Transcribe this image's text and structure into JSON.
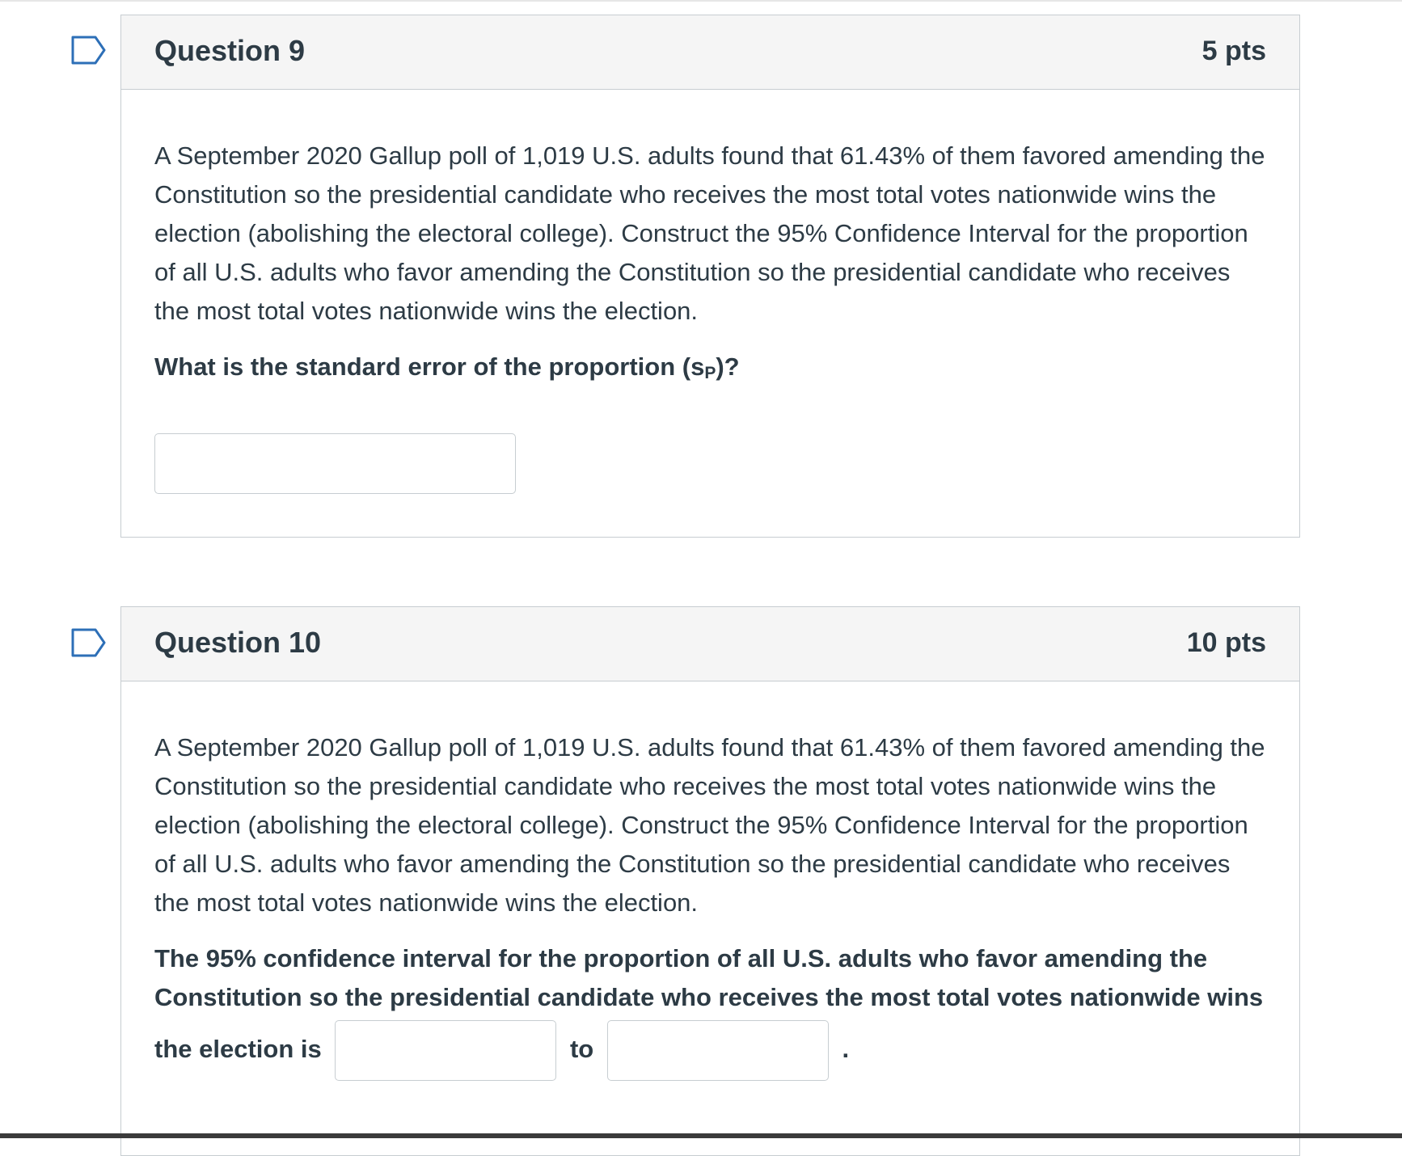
{
  "questions": [
    {
      "title": "Question 9",
      "points": "5 pts",
      "text": "A September 2020 Gallup poll of 1,019 U.S. adults found that 61.43% of them favored amending the Constitution so the presidential candidate who receives the most total votes nationwide wins the election (abolishing the electoral college). Construct the 95% Confidence Interval for the proportion of all U.S. adults who favor amending the Constitution so the presidential candidate who receives the most total votes nationwide wins the election.",
      "prompt_before": "What is the standard error of the proportion (s",
      "prompt_sub": "P",
      "prompt_after": ")?",
      "answer_value": ""
    },
    {
      "title": "Question 10",
      "points": "10 pts",
      "text": "A September 2020 Gallup poll of 1,019 U.S. adults found that 61.43% of them favored amending the Constitution so the presidential candidate who receives the most total votes nationwide wins the election (abolishing the electoral college). Construct the 95% Confidence Interval for the proportion of all U.S. adults who favor amending the Constitution so the presidential candidate who receives the most total votes nationwide wins the election.",
      "prompt": "The 95% confidence interval for the proportion of all U.S. adults who favor amending the Constitution so the presidential candidate who receives the most total votes nationwide wins",
      "prompt_end": "the election is",
      "connector": "to",
      "period": ".",
      "lower_value": "",
      "upper_value": ""
    }
  ],
  "icons": {
    "flag": "flag-question-icon"
  },
  "colors": {
    "text": "#2d3b45",
    "header_bg": "#f5f5f5",
    "border": "#c7cdd1",
    "flag_stroke": "#2d6fb7"
  }
}
